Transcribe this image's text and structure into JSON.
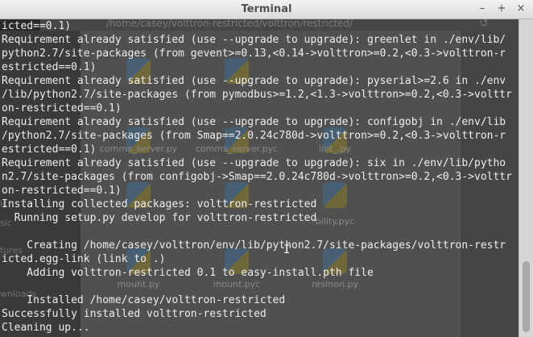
{
  "window": {
    "title": "Terminal",
    "controls": {
      "minimize": "–",
      "maximize": "+",
      "close": "×"
    }
  },
  "background": {
    "path": "/home/casey/volttron-restricted/volttron/restricted/",
    "refresh_icon": "↺",
    "sidebar": [
      "ic",
      "sic",
      "tures",
      "wnloads"
    ],
    "files": [
      "comms_server.py",
      "comms_server.pyc",
      "init_.py",
      "bility.pyc",
      "mount.py",
      "mount.pyc",
      "resmon.py"
    ]
  },
  "terminal": {
    "lines": [
      "icted==0.1)",
      "Requirement already satisfied (use --upgrade to upgrade): greenlet in ./env/lib/",
      "python2.7/site-packages (from gevent>=0.13,<0.14->volttron>=0.2,<0.3->volttron-r",
      "estricted==0.1)",
      "Requirement already satisfied (use --upgrade to upgrade): pyserial>=2.6 in ./env",
      "/lib/python2.7/site-packages (from pymodbus>=1.2,<1.3->volttron>=0.2,<0.3->volttr",
      "on-restricted==0.1)",
      "Requirement already satisfied (use --upgrade to upgrade): configobj in ./env/lib",
      "/python2.7/site-packages (from Smap==2.0.24c780d->volttron>=0.2,<0.3->volttron-r",
      "estricted==0.1)",
      "Requirement already satisfied (use --upgrade to upgrade): six in ./env/lib/pytho",
      "n2.7/site-packages (from configobj->Smap==2.0.24c780d->volttron>=0.2,<0.3->volttr",
      "on-restricted==0.1)",
      "Installing collected packages: volttron-restricted",
      "  Running setup.py develop for volttron-restricted",
      "",
      "    Creating /home/casey/volttron/env/lib/python2.7/site-packages/volttron-restr",
      "icted.egg-link (link to .)",
      "    Adding volttron-restricted 0.1 to easy-install.pth file",
      "",
      "    Installed /home/casey/volttron-restricted",
      "Successfully installed volttron-restricted",
      "Cleaning up..."
    ],
    "colors": {
      "foreground": "#eeeeee",
      "background": "#2a2a2a"
    }
  },
  "mouse_cursor": "I"
}
